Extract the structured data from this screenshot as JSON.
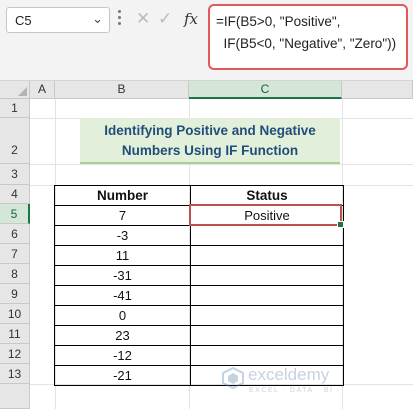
{
  "formula_bar": {
    "name_box": "C5",
    "fx_label": "fx",
    "formula_line1": "=IF(B5>0, \"Positive\",",
    "formula_line2": "  IF(B5<0, \"Negative\", \"Zero\"))"
  },
  "columns": [
    "A",
    "B",
    "C"
  ],
  "rows": [
    "1",
    "2",
    "3",
    "4",
    "5",
    "6",
    "7",
    "8",
    "9",
    "10",
    "11",
    "12",
    "13"
  ],
  "selected_cell": "C5",
  "title_line1": "Identifying Positive and Negative",
  "title_line2": "Numbers Using IF Function",
  "table": {
    "headers": [
      "Number",
      "Status"
    ],
    "rows": [
      {
        "number": "7",
        "status": "Positive"
      },
      {
        "number": "-3",
        "status": ""
      },
      {
        "number": "11",
        "status": ""
      },
      {
        "number": "-31",
        "status": ""
      },
      {
        "number": "-41",
        "status": ""
      },
      {
        "number": "0",
        "status": ""
      },
      {
        "number": "23",
        "status": ""
      },
      {
        "number": "-12",
        "status": ""
      },
      {
        "number": "-21",
        "status": ""
      }
    ]
  },
  "watermark": {
    "name": "exceldemy",
    "tagline": "EXCEL · DATA · BI"
  },
  "colors": {
    "accent_green": "#217346",
    "title_bg": "#e2efda",
    "title_text": "#1f4e79",
    "highlight_red": "#e05a5a"
  }
}
